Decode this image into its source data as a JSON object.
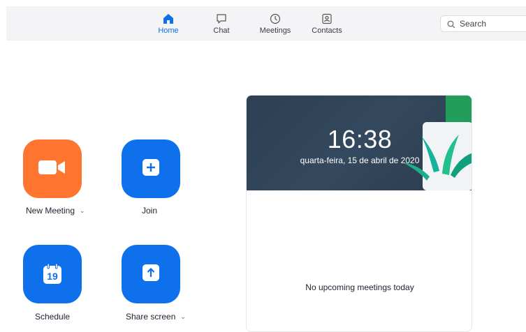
{
  "nav": {
    "tabs": [
      {
        "label": "Home",
        "icon": "home-icon",
        "active": true
      },
      {
        "label": "Chat",
        "icon": "chat-icon",
        "active": false
      },
      {
        "label": "Meetings",
        "icon": "clock-icon",
        "active": false
      },
      {
        "label": "Contacts",
        "icon": "contacts-icon",
        "active": false
      }
    ],
    "search": {
      "placeholder": "Search",
      "icon": "search-icon"
    }
  },
  "actions": [
    {
      "label": "New Meeting",
      "icon": "video-camera-icon",
      "color": "#ff742e",
      "has_dropdown": true
    },
    {
      "label": "Join",
      "icon": "plus-icon",
      "color": "#0e71eb",
      "has_dropdown": false
    },
    {
      "label": "Schedule",
      "icon": "calendar-icon",
      "calendar_day": "19",
      "color": "#0e71eb",
      "has_dropdown": false
    },
    {
      "label": "Share screen",
      "icon": "share-up-arrow-icon",
      "color": "#0e71eb",
      "has_dropdown": true
    }
  ],
  "meetings_card": {
    "time": "16:38",
    "date": "quarta-feira, 15 de abril de 2020",
    "empty_message": "No upcoming meetings today"
  },
  "colors": {
    "accent": "#0e71eb",
    "new_meeting": "#ff742e",
    "banner": "#2d3f52"
  }
}
